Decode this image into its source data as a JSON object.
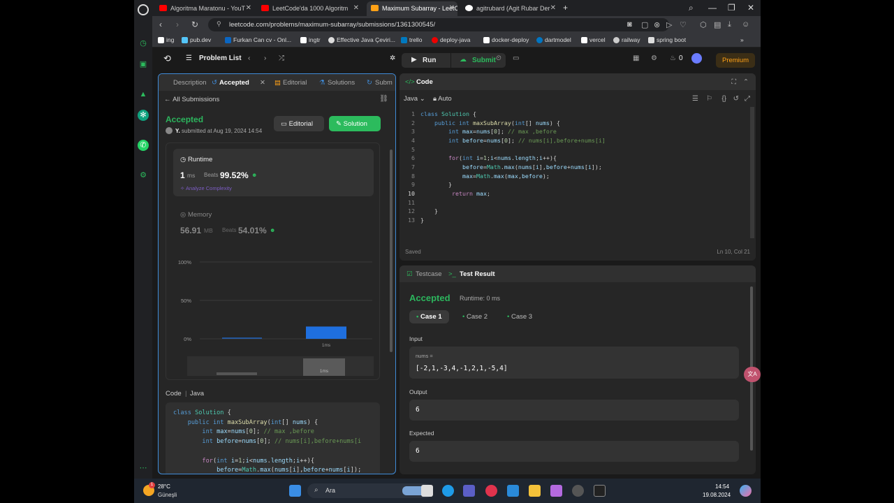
{
  "browser": {
    "tabs": [
      {
        "title": "Algoritma Maratonu - YouT",
        "active": false
      },
      {
        "title": "LeetCode'da 1000 Algoritm",
        "active": false
      },
      {
        "title": "Maximum Subarray - LeetC",
        "active": true
      },
      {
        "title": "agitrubard (Agit Rubar Der",
        "active": false
      }
    ],
    "new_tab": "+",
    "url": "leetcode.com/problems/maximum-subarray/submissions/1361300545/",
    "bookmarks": [
      "ing",
      "pub.dev",
      "Furkan Can cv - Onl...",
      "ingtr",
      "Effective Java Çeviri...",
      "trello",
      "deploy-java",
      "docker-deploy",
      "dartmodel",
      "vercel",
      "railway",
      "spring boot"
    ]
  },
  "lc_nav": {
    "problem_list": "Problem List",
    "run": "Run",
    "submit": "Submit",
    "streak": "0",
    "premium": "Premium"
  },
  "left_panel": {
    "tabs": [
      "Description",
      "Accepted",
      "Editorial",
      "Solutions",
      "Subm"
    ],
    "back": "All Submissions",
    "status": "Accepted",
    "user": "Y.",
    "submitted_text": "submitted at Aug 19, 2024 14:54",
    "editorial_btn": "Editorial",
    "solution_btn": "Solution",
    "runtime_label": "Runtime",
    "runtime_value": "1",
    "runtime_unit": "ms",
    "beats_label": "Beats",
    "runtime_beats": "99.52%",
    "analyze": "Analyze Complexity",
    "memory_label": "Memory",
    "memory_value": "56.91",
    "memory_unit": "MB",
    "memory_beats": "54.01%",
    "code_label": "Code",
    "code_lang": "Java"
  },
  "chart_data": {
    "type": "bar",
    "categories": [
      "1ms"
    ],
    "yticks": [
      "100%",
      "50%",
      "0%"
    ],
    "values": [
      0.16
    ],
    "highlight": "1ms",
    "minimap_label": "1ms",
    "ylim": [
      0,
      1
    ]
  },
  "code_panel": {
    "title": "Code",
    "language": "Java",
    "mode": "Auto",
    "status": "Saved",
    "cursor": "Ln 10, Col 21",
    "lines": [
      "class Solution {",
      "    public int maxSubArray(int[] nums) {",
      "        int max=nums[0]; // max ,before",
      "        int before=nums[0]; // nums[i],before+nums[i]",
      "",
      "        for(int i=1;i<nums.length;i++){",
      "            before=Math.max(nums[i],before+nums[i]);",
      "            max=Math.max(max,before);",
      "        }",
      "         return max;",
      "",
      "    }",
      "}"
    ],
    "preview_lines": [
      "class Solution {",
      "    public int maxSubArray(int[] nums) {",
      "        int max=nums[0]; // max ,before",
      "        int before=nums[0]; // nums[i],before+nums[i",
      "",
      "        for(int i=1;i<nums.length;i++){",
      "            before=Math.max(nums[i],before+nums[i]);"
    ]
  },
  "result_panel": {
    "tab_testcase": "Testcase",
    "tab_result": "Test Result",
    "status": "Accepted",
    "runtime": "Runtime: 0 ms",
    "cases": [
      "Case 1",
      "Case 2",
      "Case 3"
    ],
    "input_label": "Input",
    "input_var": "nums =",
    "input_value": "[-2,1,-3,4,-1,2,1,-5,4]",
    "output_label": "Output",
    "output_value": "6",
    "expected_label": "Expected",
    "expected_value": "6"
  },
  "taskbar": {
    "weather_temp": "28°C",
    "weather_desc": "Güneşli",
    "weather_badge": "1",
    "search": "Ara",
    "time": "14:54",
    "date": "19.08.2024"
  },
  "colors": {
    "accent_green": "#2cbb5d",
    "premium": "#ffa116",
    "bar_blue": "#1f6fde"
  }
}
